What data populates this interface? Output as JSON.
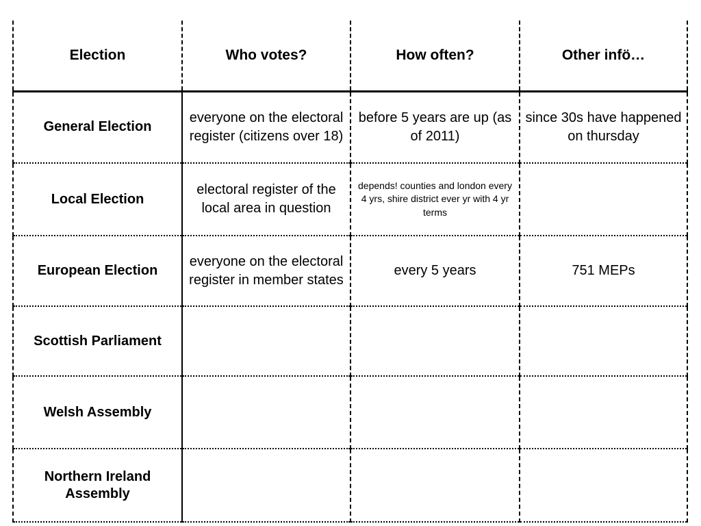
{
  "table": {
    "columns": [
      {
        "key": "election",
        "label": "Election"
      },
      {
        "key": "who",
        "label": "Who votes?"
      },
      {
        "key": "often",
        "label": "How often?"
      },
      {
        "key": "other",
        "label": "Other infö…"
      }
    ],
    "rows": [
      {
        "election": "General Election",
        "who": "everyone on the electoral register (citizens over 18)",
        "often": "before 5 years are up (as of 2011)",
        "other": "since 30s have happened on thursday",
        "often_small": false
      },
      {
        "election": "Local Election",
        "who": "electoral register of the local area in question",
        "often": "depends! counties and london every 4 yrs, shire district ever yr with 4 yr terms",
        "other": "",
        "often_small": true
      },
      {
        "election": "European Election",
        "who": "everyone on the electoral register in member states",
        "often": "every 5 years",
        "other": "751 MEPs",
        "often_small": false
      },
      {
        "election": "Scottish Parliament",
        "who": "",
        "often": "",
        "other": "",
        "often_small": false
      },
      {
        "election": "Welsh Assembly",
        "who": "",
        "often": "",
        "other": "",
        "often_small": false
      },
      {
        "election": "Northern Ireland Assembly",
        "who": "",
        "often": "",
        "other": "",
        "often_small": false
      }
    ]
  },
  "style": {
    "text_color": "#000000",
    "background_color": "#ffffff",
    "border_color": "#000000"
  }
}
